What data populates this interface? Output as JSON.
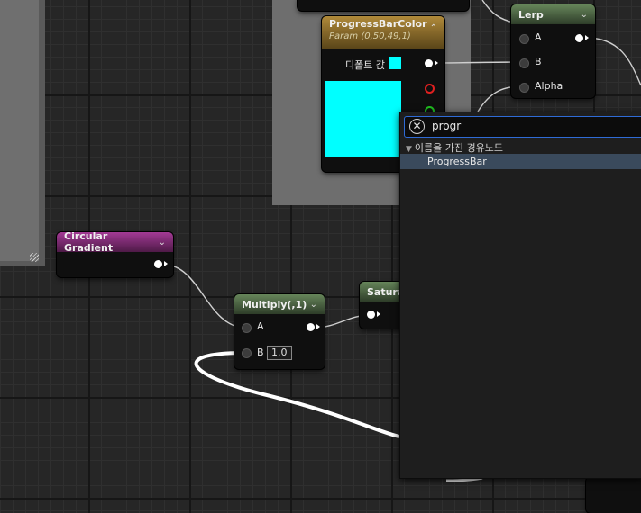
{
  "nodes": {
    "lerp": {
      "title": "Lerp",
      "pins": {
        "a": "A",
        "b": "B",
        "alpha": "Alpha"
      }
    },
    "progress_bar_color": {
      "title": "ProgressBarColor",
      "subtitle": "Param (0,50,49,1)",
      "default_label": "디폴트 값",
      "swatch_color": "#00ffff"
    },
    "circular_gradient": {
      "title": "Circular Gradient"
    },
    "multiply": {
      "title": "Multiply(,1)",
      "pins": {
        "a": "A",
        "b": "B"
      },
      "b_value": "1.0"
    },
    "saturate": {
      "title": "Satura"
    }
  },
  "search_popup": {
    "query": "progr",
    "category_label": "이름을 가진 경유노드",
    "results": [
      "ProgressBar"
    ]
  },
  "colors": {
    "accent": "#2f6bd6",
    "header_green": "#66855a",
    "header_pink": "#a33a95",
    "header_gold": "#b08a3a",
    "selection": "#3a4a5c"
  }
}
